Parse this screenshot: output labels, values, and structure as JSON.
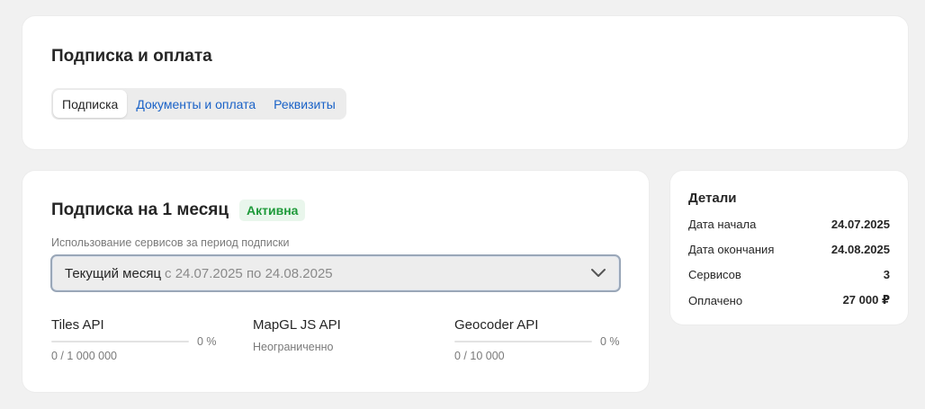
{
  "header": {
    "title": "Подписка и оплата",
    "tabs": [
      {
        "label": "Подписка",
        "active": true
      },
      {
        "label": "Документы и оплата",
        "active": false
      },
      {
        "label": "Реквизиты",
        "active": false
      }
    ]
  },
  "subscription": {
    "title": "Подписка на 1 месяц",
    "status": "Активна",
    "period_label": "Использование сервисов за период подписки",
    "period_select": {
      "current": "Текущий месяц",
      "range": "с 24.07.2025 по 24.08.2025",
      "icon": "chevron-down-icon"
    },
    "services": [
      {
        "name": "Tiles API",
        "percent": "0 %",
        "amount": "0 / 1 000 000",
        "usage_fraction": 0
      },
      {
        "name": "MapGL JS API",
        "percent": "",
        "amount": "Неограниченно",
        "usage_fraction": null
      },
      {
        "name": "Geocoder API",
        "percent": "0 %",
        "amount": "0 / 10 000",
        "usage_fraction": 0
      }
    ]
  },
  "details": {
    "title": "Детали",
    "rows": [
      {
        "label": "Дата начала",
        "value": "24.07.2025"
      },
      {
        "label": "Дата окончания",
        "value": "24.08.2025"
      },
      {
        "label": "Сервисов",
        "value": "3"
      },
      {
        "label": "Оплачено",
        "value": "27 000 ₽"
      }
    ]
  },
  "colors": {
    "background": "#f1f1f1",
    "card": "#ffffff",
    "link": "#1a62c7",
    "status_green": "#1e9a3a",
    "status_green_bg": "#e9f6ec"
  }
}
